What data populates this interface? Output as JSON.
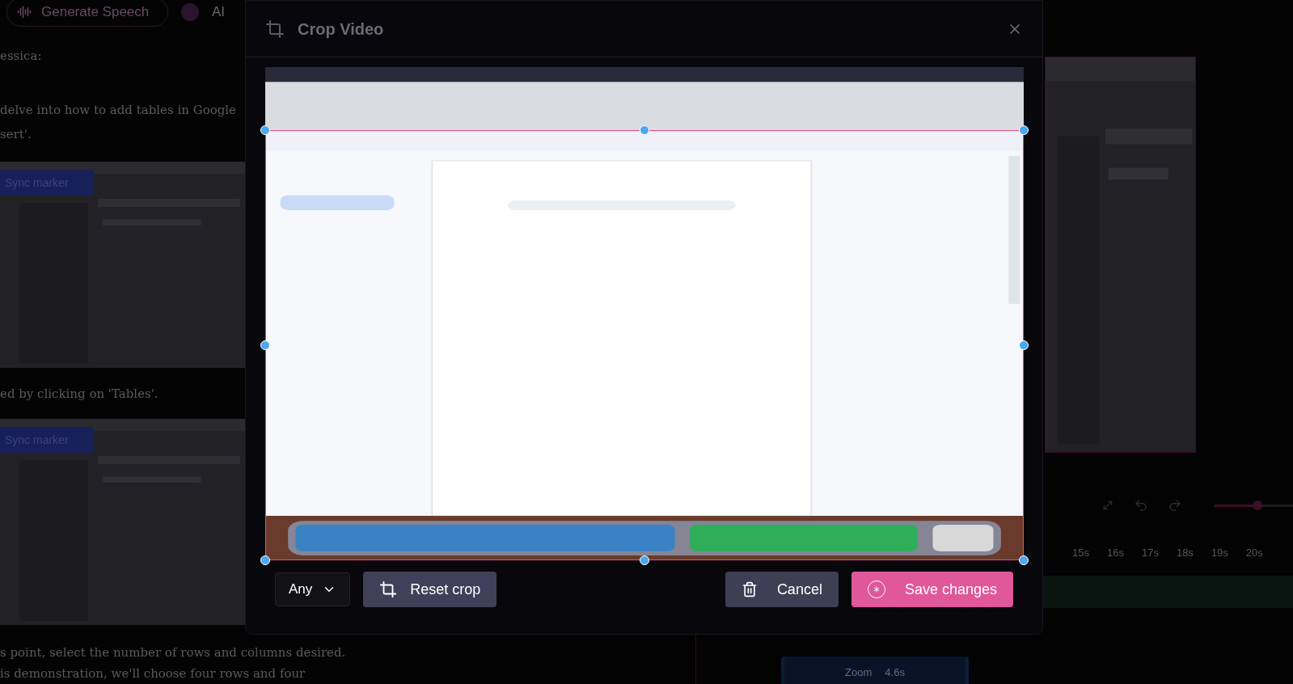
{
  "background": {
    "top_bar": {
      "generate_button": "Generate Speech",
      "ai_label": "AI"
    },
    "script": [
      {
        "kind": "text",
        "text": "essica:"
      },
      {
        "kind": "text",
        "text": "delve into how to add tables in Google"
      },
      {
        "kind": "text",
        "text": "sert'."
      },
      {
        "kind": "frame",
        "button": "Sync marker"
      },
      {
        "kind": "text",
        "text": "ed by clicking on 'Tables'."
      },
      {
        "kind": "frame",
        "button": "Sync marker"
      },
      {
        "kind": "text",
        "text": "s point, select the number of rows and columns desired."
      },
      {
        "kind": "text",
        "text": "is demonstration, we'll choose four rows and four"
      }
    ],
    "editor": {
      "slider": {
        "level": 0.55
      },
      "timeline": [
        "15s",
        "16s",
        "17s",
        "18s",
        "19s",
        "20s"
      ],
      "zoom_clip": {
        "label": "Zoom",
        "duration": "4.6s"
      }
    }
  },
  "modal": {
    "title": "Crop Video",
    "aspect_select": {
      "value": "Any"
    },
    "buttons": [
      {
        "kind": "reset",
        "label": "Reset crop"
      },
      {
        "kind": "cancel",
        "label": "Cancel"
      },
      {
        "kind": "save",
        "label": "Save changes"
      }
    ]
  }
}
